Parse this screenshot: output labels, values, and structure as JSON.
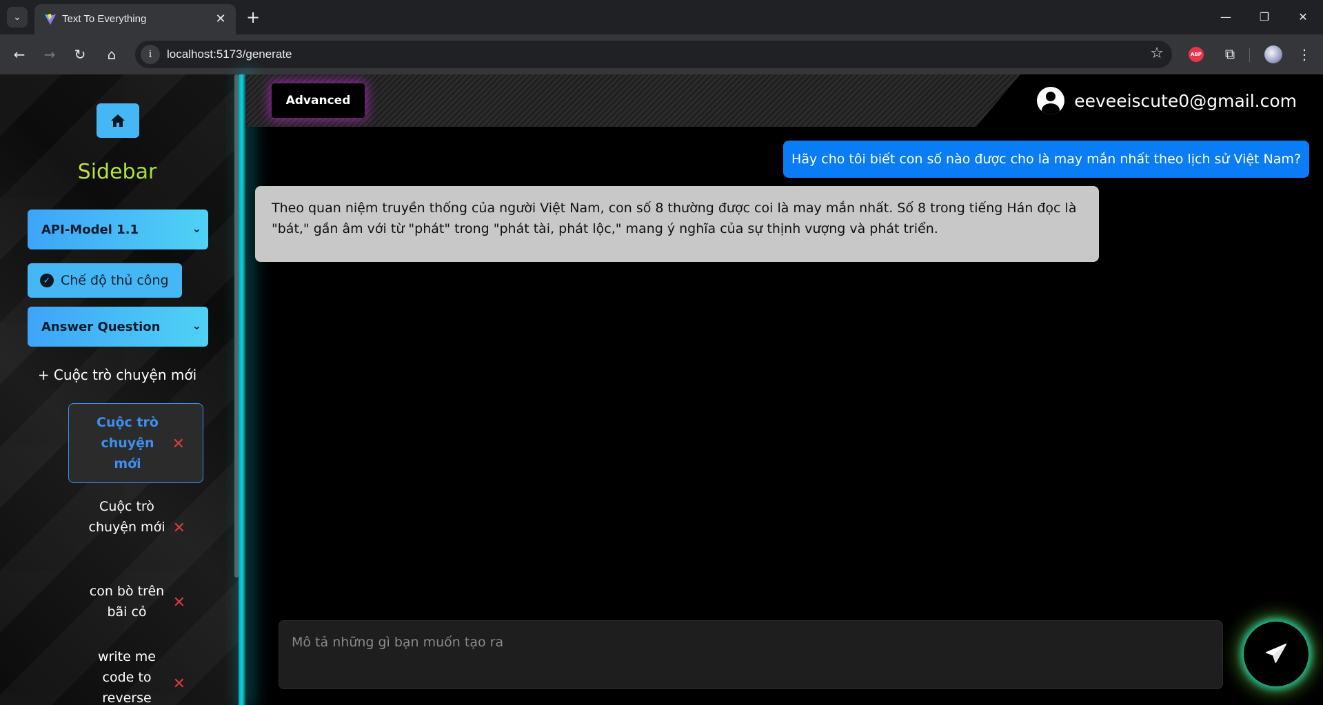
{
  "browser": {
    "tab_title": "Text To Everything",
    "url": "localhost:5173/generate",
    "extension_label": "ABP"
  },
  "sidebar": {
    "title": "Sidebar",
    "model_select": "API-Model 1.1",
    "manual_mode_label": "Chế độ thủ công",
    "task_select": "Answer Question",
    "new_chat_label": "+ Cuộc trò chuyện mới",
    "chats": [
      {
        "label": "Cuộc trò chuyện mới",
        "active": true
      },
      {
        "label": "Cuộc trò chuyện mới",
        "active": false
      },
      {
        "label": "con bò trên bãi cỏ",
        "active": false
      },
      {
        "label": "write me code to reverse",
        "active": false
      }
    ]
  },
  "header": {
    "advanced_label": "Advanced",
    "user_email": "eeveeiscute0@gmail.com"
  },
  "messages": {
    "user": "Hãy cho tôi biết con số nào được cho là may mắn nhất theo lịch sử Việt Nam?",
    "bot": "Theo quan niệm truyền thống của người Việt Nam, con số 8 thường được coi là may mắn nhất. Số 8 trong tiếng Hán đọc là \"bát,\" gần âm với từ \"phát\" trong \"phát tài, phát lộc,\" mang ý nghĩa của sự thịnh vượng và phát triển."
  },
  "composer": {
    "placeholder": "Mô tả những gì bạn muốn tạo ra"
  },
  "colors": {
    "accent_blue": "#45b7f4",
    "user_bubble": "#0a7cf5",
    "bot_bubble": "#c8c8c8",
    "glow_teal": "#0fd4de",
    "glow_purple": "#be28c8"
  }
}
